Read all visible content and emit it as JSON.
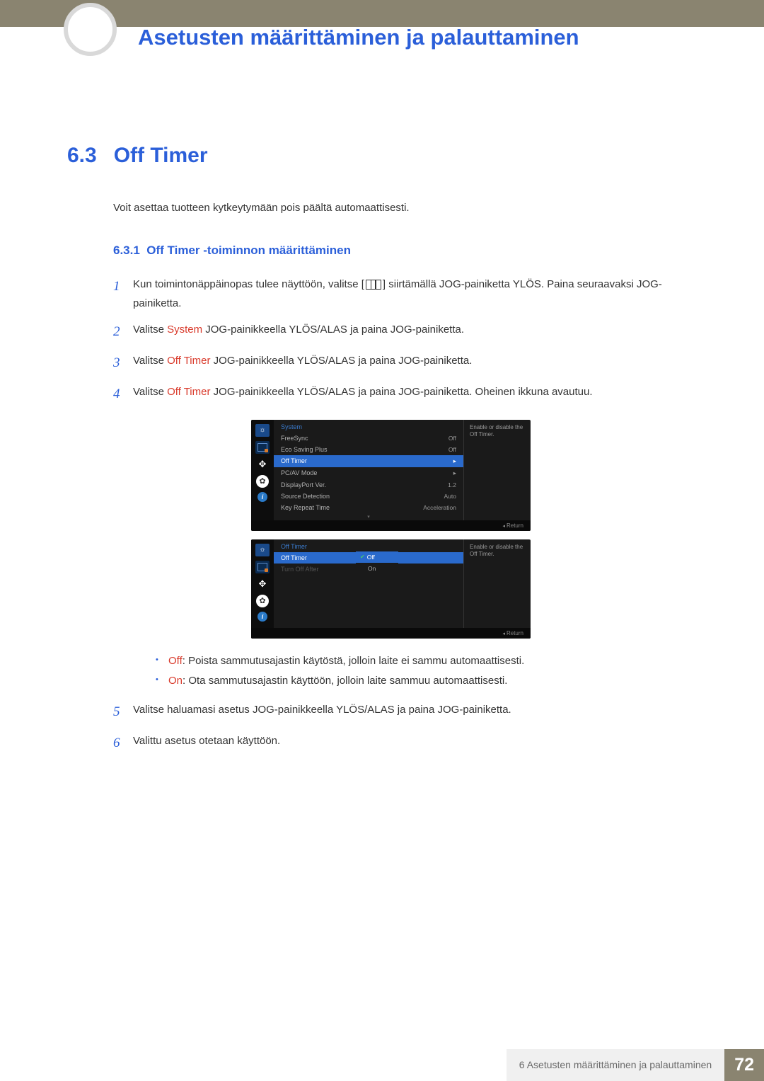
{
  "chapter_title": "Asetusten määrittäminen ja palauttaminen",
  "section": {
    "num": "6.3",
    "title": "Off Timer"
  },
  "intro": "Voit asettaa tuotteen kytkeytymään pois päältä automaattisesti.",
  "subsection": {
    "num": "6.3.1",
    "title": "Off Timer -toiminnon määrittäminen"
  },
  "steps": {
    "s1a": "Kun toimintonäppäinopas tulee näyttöön, valitse [",
    "s1b": "] siirtämällä JOG-painiketta YLÖS. Paina seuraavaksi JOG-painiketta.",
    "s2a": "Valitse ",
    "s2_sys": "System",
    "s2b": " JOG-painikkeella YLÖS/ALAS ja paina JOG-painiketta.",
    "s3a": "Valitse ",
    "s3_ot": "Off Timer",
    "s3b": " JOG-painikkeella YLÖS/ALAS ja paina JOG-painiketta.",
    "s4a": "Valitse ",
    "s4_ot": "Off Timer",
    "s4b": " JOG-painikkeella YLÖS/ALAS ja paina JOG-painiketta. Oheinen ikkuna avautuu.",
    "s5": "Valitse haluamasi asetus JOG-painikkeella YLÖS/ALAS ja paina JOG-painiketta.",
    "s6": "Valittu asetus otetaan käyttöön."
  },
  "bullets": {
    "off_l": "Off",
    "off_t": ": Poista sammutusajastin käytöstä, jolloin laite ei sammu automaattisesti.",
    "on_l": "On",
    "on_t": ": Ota sammutusajastin käyttöön, jolloin laite sammuu automaattisesti."
  },
  "osd1": {
    "title": "System",
    "help": "Enable or disable the Off Timer.",
    "rows": [
      {
        "label": "FreeSync",
        "val": "Off"
      },
      {
        "label": "Eco Saving Plus",
        "val": "Off"
      },
      {
        "label": "Off Timer",
        "val": "▸",
        "hl": true
      },
      {
        "label": "PC/AV Mode",
        "val": "▸"
      },
      {
        "label": "DisplayPort Ver.",
        "val": "1.2"
      },
      {
        "label": "Source Detection",
        "val": "Auto"
      },
      {
        "label": "Key Repeat Time",
        "val": "Acceleration"
      }
    ],
    "return": "Return"
  },
  "osd2": {
    "title": "Off Timer",
    "help": "Enable or disable the Off Timer.",
    "rows": [
      {
        "label": "Off Timer",
        "hl": true
      },
      {
        "label": "Turn Off After",
        "dim": true
      }
    ],
    "dd": [
      {
        "label": "Off",
        "sel": true,
        "check": true
      },
      {
        "label": "On"
      }
    ],
    "return": "Return"
  },
  "footer": {
    "text": "6 Asetusten määrittäminen ja palauttaminen",
    "page": "72"
  }
}
